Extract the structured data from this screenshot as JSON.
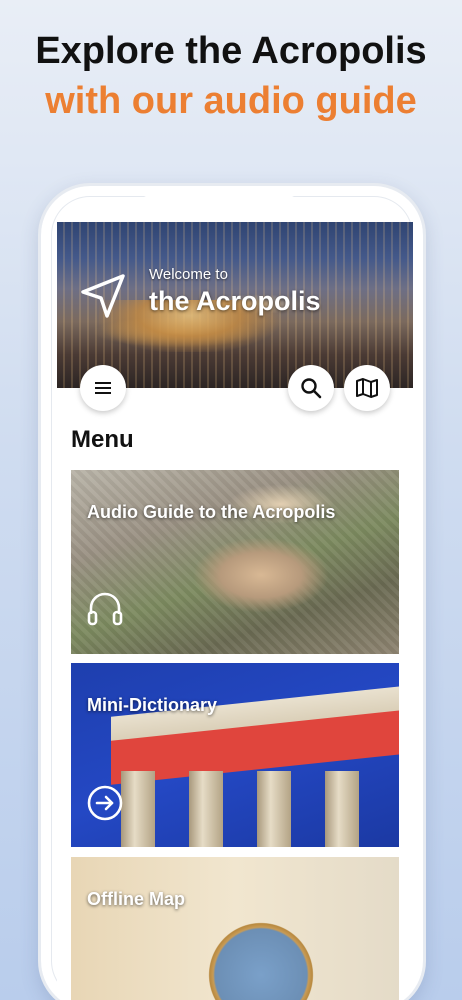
{
  "headline": {
    "line1": "Explore the Acropolis",
    "line2": "with our audio guide"
  },
  "colors": {
    "accent": "#ec7f32",
    "headline": "#111111",
    "card_blue": "#2448c4",
    "card_red_band": "#e0453d"
  },
  "app": {
    "hero": {
      "welcome_small": "Welcome to",
      "welcome_big": "the Acropolis",
      "nav_icon": "navigation-arrow-icon"
    },
    "buttons": {
      "menu_icon": "hamburger-menu-icon",
      "search_icon": "search-icon",
      "map_icon": "map-icon"
    },
    "menu_title": "Menu",
    "cards": [
      {
        "title": "Audio Guide to the Acropolis",
        "icon": "headphones-icon"
      },
      {
        "title": "Mini-Dictionary",
        "icon": "arrow-right-circle-icon"
      },
      {
        "title": "Offline Map",
        "icon": ""
      }
    ]
  }
}
